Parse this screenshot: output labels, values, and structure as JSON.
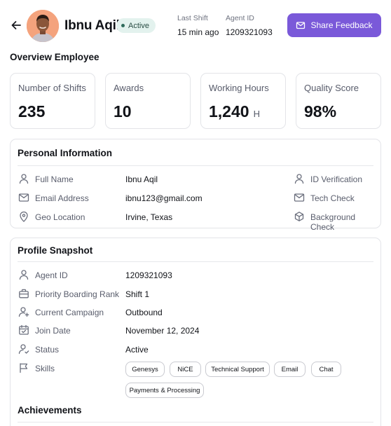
{
  "header": {
    "name": "Ibnu Aqil",
    "status": "Active",
    "last_shift_label": "Last Shift",
    "last_shift_value": "15 min ago",
    "agent_id_label": "Agent ID",
    "agent_id_value": "1209321093",
    "share_button": "Share Feedback"
  },
  "overview": {
    "title": "Overview Employee",
    "stats": [
      {
        "label": "Number of Shifts",
        "value": "235",
        "unit": ""
      },
      {
        "label": "Awards",
        "value": "10",
        "unit": ""
      },
      {
        "label": "Working Hours",
        "value": "1,240",
        "unit": "H"
      },
      {
        "label": "Quality Score",
        "value": "98%",
        "unit": ""
      }
    ]
  },
  "personal": {
    "title": "Personal Information",
    "rows": [
      {
        "icon": "user-icon",
        "label": "Full Name",
        "value": "Ibnu Aqil"
      },
      {
        "icon": "mail-icon",
        "label": "Email Address",
        "value": "ibnu123@gmail.com"
      },
      {
        "icon": "location-pin-icon",
        "label": "Geo Location",
        "value": "Irvine, Texas"
      }
    ],
    "checks": [
      {
        "icon": "user-icon",
        "label": "ID Verification"
      },
      {
        "icon": "mail-icon",
        "label": "Tech Check"
      },
      {
        "icon": "cube-icon",
        "label": "Background Check"
      }
    ]
  },
  "profile": {
    "title": "Profile Snapshot",
    "rows": [
      {
        "icon": "user-icon",
        "label": "Agent ID",
        "value": "1209321093"
      },
      {
        "icon": "briefcase-icon",
        "label": "Priority Boarding Rank",
        "value": "Shift 1"
      },
      {
        "icon": "user-plus-icon",
        "label": "Current Campaign",
        "value": "Outbound"
      },
      {
        "icon": "calendar-icon",
        "label": "Join Date",
        "value": "November 12, 2024"
      },
      {
        "icon": "user-status-icon",
        "label": "Status",
        "value": "Active"
      },
      {
        "icon": "flag-icon",
        "label": "Skills",
        "value": ""
      }
    ],
    "skills": [
      "Genesys",
      "NiCE",
      "Technical Support",
      "Email",
      "Chat",
      "Payments & Processing"
    ],
    "achievements_title": "Achievements"
  },
  "colors": {
    "accent": "#7a59d9",
    "badge_bg": "#e3f2ee",
    "badge_text": "#2a4d44",
    "border": "#e3e4e8"
  }
}
